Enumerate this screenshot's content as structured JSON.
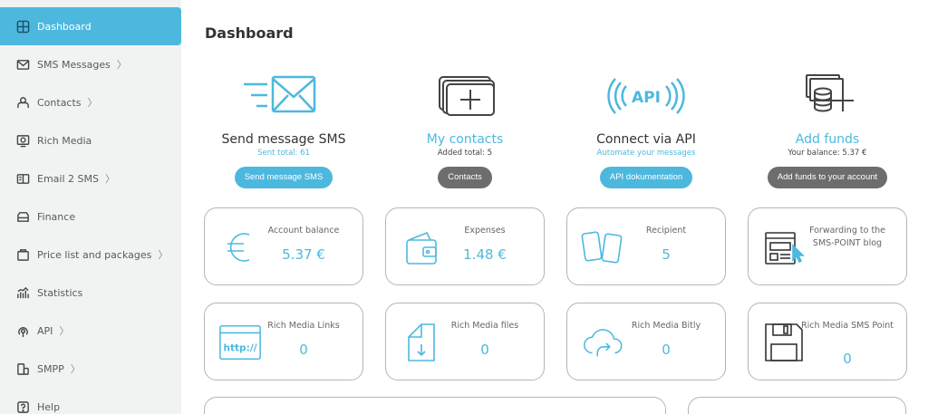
{
  "sidebar": {
    "items": [
      {
        "label": "Dashboard",
        "icon": "dashboard-icon",
        "chevron": false,
        "active": true
      },
      {
        "label": "SMS Messages",
        "icon": "envelope-icon",
        "chevron": true
      },
      {
        "label": "Contacts",
        "icon": "contacts-icon",
        "chevron": true
      },
      {
        "label": "Rich Media",
        "icon": "rich-media-icon",
        "chevron": false
      },
      {
        "label": "Email 2 SMS",
        "icon": "email-sms-icon",
        "chevron": true
      },
      {
        "label": "Finance",
        "icon": "finance-icon",
        "chevron": false
      },
      {
        "label": "Price list and packages",
        "icon": "price-list-icon",
        "chevron": true
      },
      {
        "label": "Statistics",
        "icon": "statistics-icon",
        "chevron": false
      },
      {
        "label": "API",
        "icon": "api-icon",
        "chevron": true
      },
      {
        "label": "SMPP",
        "icon": "smpp-icon",
        "chevron": true
      },
      {
        "label": "Help",
        "icon": "help-icon",
        "chevron": false
      }
    ],
    "chevron_glyph": "〉"
  },
  "page": {
    "title": "Dashboard"
  },
  "features": [
    {
      "title": "Send message SMS",
      "sub": "Sent total: 61",
      "button": "Send message SMS"
    },
    {
      "title": "My contacts",
      "sub": "Added total: 5",
      "button": "Contacts"
    },
    {
      "title": "Connect via API",
      "sub": "Automate your messages",
      "button": "API dokumentation"
    },
    {
      "title": "Add funds",
      "sub": "Your balance: 5.37 €",
      "button": "Add funds to your account"
    }
  ],
  "api_icon_text": "API",
  "stats": [
    {
      "label": "Account balance",
      "value": "5.37 €"
    },
    {
      "label": "Expenses",
      "value": "1.48 €"
    },
    {
      "label": "Recipient",
      "value": "5"
    },
    {
      "label": "Forwarding to the SMS-POINT blog",
      "value": ""
    },
    {
      "label": "Rich Media Links",
      "value": "0"
    },
    {
      "label": "Rich Media files",
      "value": "0"
    },
    {
      "label": "Rich Media Bitly",
      "value": "0"
    },
    {
      "label": "Rich Media SMS Point",
      "value": "0"
    }
  ],
  "http_icon_text": "http://",
  "colors": {
    "accent": "#4db8de",
    "button_gray": "#6d6d6d",
    "sidebar_bg": "#f1f2f2"
  }
}
